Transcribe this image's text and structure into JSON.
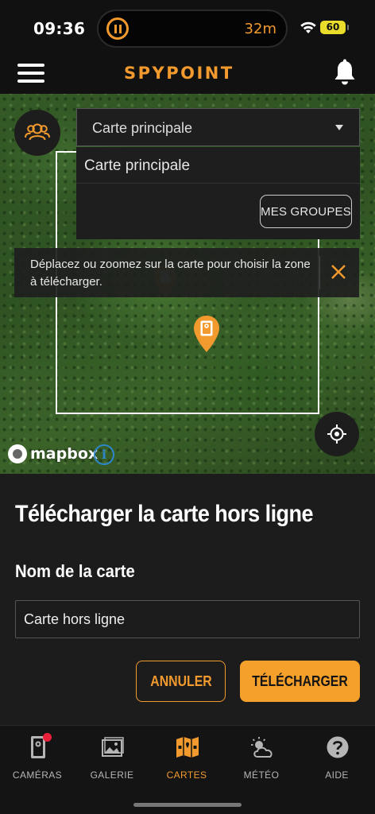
{
  "status_bar": {
    "time": "09:36",
    "timer": "32m",
    "battery": "60",
    "icons": [
      "pause-icon",
      "wifi-icon",
      "battery-icon"
    ]
  },
  "header": {
    "logo": "SPYPOINT",
    "icons": [
      "menu-icon",
      "bell-icon"
    ]
  },
  "map": {
    "dropdown": {
      "selected": "Carte principale",
      "options": [
        "Carte principale"
      ],
      "groups_button": "MES GROUPES"
    },
    "hint": "Déplacez ou zoomez sur la carte pour choisir la zone à télécharger.",
    "attribution": "mapbox",
    "icons": [
      "groups-icon",
      "close-icon",
      "camera-pin-icon",
      "locate-icon",
      "info-icon"
    ]
  },
  "sheet": {
    "title": "Télécharger la carte hors ligne",
    "name_label": "Nom de la carte",
    "name_value": "Carte hors ligne",
    "cancel_label": "ANNULER",
    "download_label": "TÉLÉCHARGER"
  },
  "tabs": [
    {
      "label": "CAMÉRAS",
      "icon": "camera-icon",
      "active": false,
      "badge": true
    },
    {
      "label": "GALERIE",
      "icon": "gallery-icon",
      "active": false
    },
    {
      "label": "CARTES",
      "icon": "map-icon",
      "active": true
    },
    {
      "label": "MÉTÉO",
      "icon": "weather-icon",
      "active": false
    },
    {
      "label": "AIDE",
      "icon": "help-icon",
      "active": false
    }
  ],
  "colors": {
    "accent": "#f29a2e",
    "button_fill": "#f6a02c",
    "badge": "#e8203a",
    "background": "#1c1c1c"
  }
}
